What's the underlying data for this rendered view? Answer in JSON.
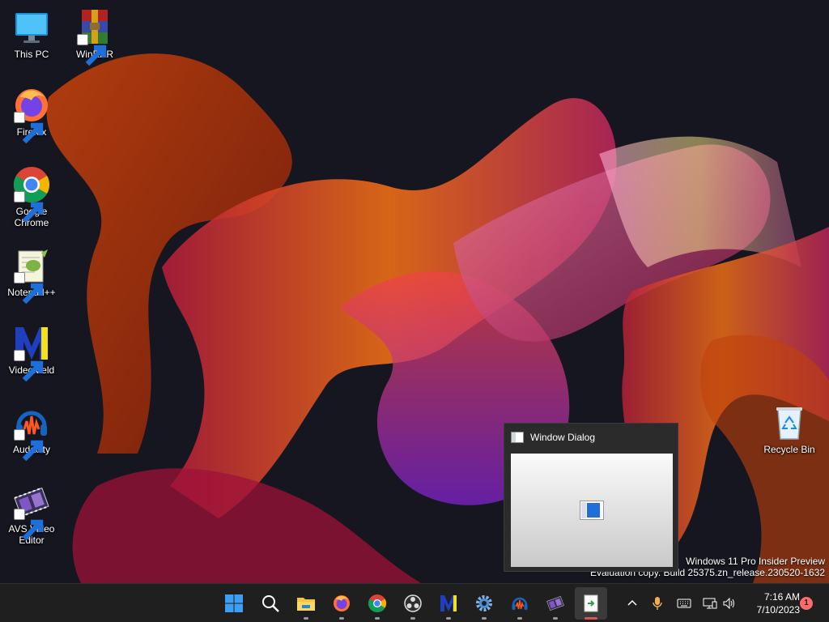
{
  "desktop": {
    "icons": [
      {
        "label": "This PC",
        "icon": "computer-icon",
        "shortcut": false
      },
      {
        "label": "WinRAR",
        "icon": "winrar-icon",
        "shortcut": true
      },
      {
        "label": "Firefox",
        "icon": "firefox-icon",
        "shortcut": true
      },
      {
        "label": "Google Chrome",
        "icon": "chrome-icon",
        "shortcut": true
      },
      {
        "label": "Notepad++",
        "icon": "notepadpp-icon",
        "shortcut": true
      },
      {
        "label": "VideoMeld",
        "icon": "videomeld-icon",
        "shortcut": true
      },
      {
        "label": "Audacity",
        "icon": "audacity-icon",
        "shortcut": true
      },
      {
        "label": "AVS Video Editor",
        "icon": "avs-video-editor-icon",
        "shortcut": true
      },
      {
        "label": "Recycle Bin",
        "icon": "recycle-bin-icon",
        "shortcut": false
      }
    ]
  },
  "watermark": {
    "line1": "Windows 11 Pro Insider Preview",
    "line2": "Evaluation copy. Build 25375.zn_release.230520-1632"
  },
  "dialog": {
    "title": "Window Dialog"
  },
  "taskbar": {
    "apps": [
      "start-icon",
      "search-icon",
      "file-explorer-icon",
      "firefox-icon",
      "chrome-icon",
      "obs-icon",
      "videomeld-icon",
      "settings-icon",
      "audacity-icon",
      "avs-video-editor-icon",
      "window-dialog-app-icon"
    ],
    "active_app": "window-dialog-app-icon",
    "tray": [
      "chevron-up-icon",
      "microphone-icon",
      "keyboard-icon",
      "network-icon",
      "volume-icon"
    ],
    "time": "7:16 AM",
    "date": "7/10/2023",
    "notification_count": "1"
  },
  "colors": {
    "taskbar_bg": "#1f1f1f",
    "accent": "#0078d4",
    "notification_badge": "#ff6b6b"
  }
}
